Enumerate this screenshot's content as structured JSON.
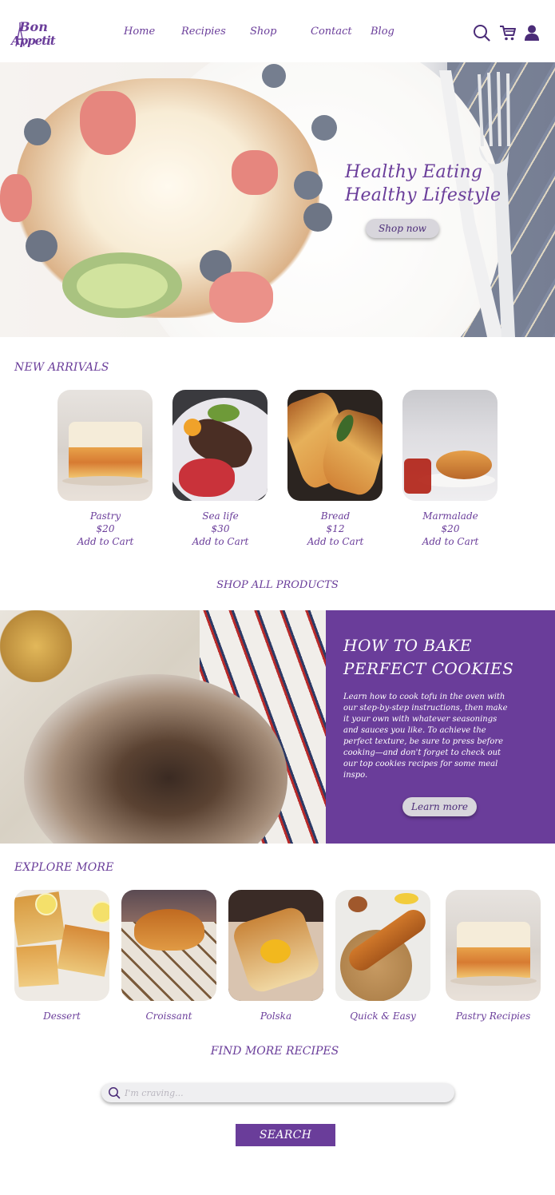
{
  "brand": {
    "logo_top": "Bon",
    "logo_bottom": "Appetit"
  },
  "nav": {
    "items": [
      "Home",
      "Recipies",
      "Shop",
      "Contact",
      "Blog"
    ]
  },
  "header_icons": [
    "search-icon",
    "cart-icon",
    "user-icon"
  ],
  "hero": {
    "title_line1": "Healthy Eating",
    "title_line2": "Healthy Lifestyle",
    "button": "Shop now"
  },
  "new_arrivals": {
    "heading": "NEW ARRIVALS",
    "items": [
      {
        "name": "Pastry",
        "price": "$20",
        "cta": "Add to Cart"
      },
      {
        "name": "Sea life",
        "price": "$30",
        "cta": "Add to Cart"
      },
      {
        "name": "Bread",
        "price": "$12",
        "cta": "Add to Cart"
      },
      {
        "name": "Marmalade",
        "price": "$20",
        "cta": "Add to Cart"
      }
    ],
    "shop_all": "SHOP ALL PRODUCTS"
  },
  "cookies": {
    "title_line1": "HOW TO BAKE",
    "title_line2": "PERFECT COOKIES",
    "body": "Learn how to cook tofu in the oven with our step-by-step instructions, then make it your own with whatever seasonings and sauces you like. To achieve the perfect texture, be sure to press before cooking—and don't forget to check out our top cookies recipes for some meal inspo.",
    "button": "Learn more"
  },
  "explore": {
    "heading": "EXPLORE MORE",
    "items": [
      "Dessert",
      "Croissant",
      "Polska",
      "Quick & Easy",
      "Pastry Recipies"
    ]
  },
  "find": {
    "heading": "FIND MORE RECIPES",
    "placeholder": "I'm craving...",
    "button": "SEARCH"
  },
  "colors": {
    "accent": "#6a3d9a",
    "button_bg": "#d8d6dc",
    "page_bg": "#ffffff"
  }
}
